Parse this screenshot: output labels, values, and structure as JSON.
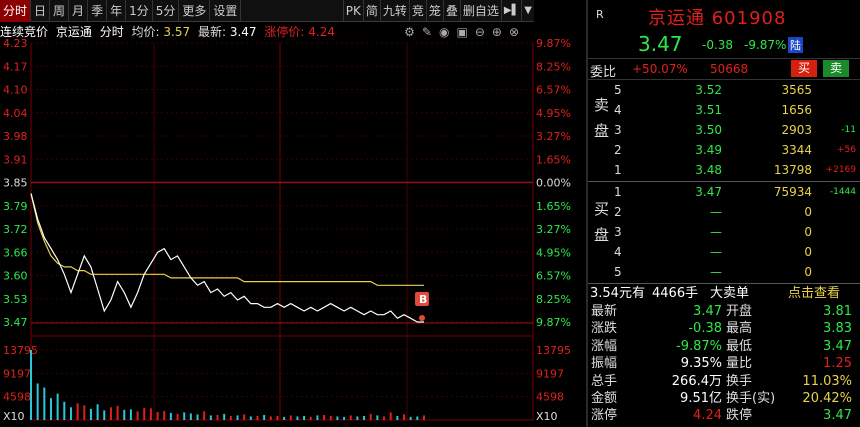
{
  "tabs": [
    "分时",
    "日",
    "周",
    "月",
    "季",
    "年",
    "1分",
    "5分",
    "更多",
    "设置"
  ],
  "tools": [
    "PK",
    "简",
    "九转",
    "竞",
    "笼",
    "叠",
    "删自选"
  ],
  "info": {
    "auction": "连续竞价",
    "name": "京运通",
    "kind": "分时",
    "avg_label": "均价:",
    "avg": "3.57",
    "last_label": "最新:",
    "last": "3.47",
    "limit_label": "涨停价:",
    "limit": "4.24"
  },
  "chart_data": {
    "type": "line",
    "prev_close": 3.85,
    "ylim": [
      3.47,
      4.23
    ],
    "left_ticks": [
      "4.23",
      "4.17",
      "4.10",
      "4.04",
      "3.98",
      "3.91",
      "3.85",
      "3.79",
      "3.72",
      "3.66",
      "3.60",
      "3.53",
      "3.47"
    ],
    "right_ticks": [
      "9.87%",
      "8.25%",
      "6.57%",
      "4.95%",
      "3.27%",
      "1.65%",
      "0.00%",
      "1.65%",
      "3.27%",
      "4.95%",
      "6.57%",
      "8.25%",
      "9.87%"
    ],
    "vol_left_ticks": [
      "13795",
      "9197",
      "4598"
    ],
    "vol_right_ticks": [
      "13795",
      "9197",
      "4598"
    ],
    "vol_unit": "X10",
    "marker": "B",
    "price": [
      3.82,
      3.75,
      3.7,
      3.67,
      3.64,
      3.6,
      3.55,
      3.6,
      3.65,
      3.62,
      3.56,
      3.5,
      3.53,
      3.58,
      3.55,
      3.51,
      3.55,
      3.6,
      3.63,
      3.66,
      3.67,
      3.64,
      3.65,
      3.62,
      3.59,
      3.57,
      3.58,
      3.55,
      3.56,
      3.54,
      3.55,
      3.53,
      3.54,
      3.52,
      3.52,
      3.51,
      3.51,
      3.52,
      3.51,
      3.52,
      3.51,
      3.5,
      3.51,
      3.5,
      3.51,
      3.52,
      3.51,
      3.5,
      3.51,
      3.5,
      3.49,
      3.5,
      3.49,
      3.49,
      3.5,
      3.48,
      3.49,
      3.48,
      3.47,
      3.47
    ],
    "avg_line": [
      3.82,
      3.74,
      3.69,
      3.65,
      3.63,
      3.62,
      3.62,
      3.61,
      3.61,
      3.6,
      3.6,
      3.6,
      3.6,
      3.6,
      3.6,
      3.6,
      3.6,
      3.6,
      3.6,
      3.6,
      3.6,
      3.59,
      3.59,
      3.59,
      3.59,
      3.59,
      3.59,
      3.59,
      3.59,
      3.59,
      3.59,
      3.59,
      3.58,
      3.58,
      3.58,
      3.58,
      3.58,
      3.58,
      3.58,
      3.58,
      3.58,
      3.58,
      3.58,
      3.58,
      3.58,
      3.58,
      3.58,
      3.58,
      3.58,
      3.58,
      3.58,
      3.58,
      3.57,
      3.57,
      3.57,
      3.57,
      3.57,
      3.57,
      3.57,
      3.57
    ],
    "volume": [
      13795,
      7200,
      6400,
      4300,
      5200,
      3600,
      2500,
      3300,
      2900,
      2200,
      3100,
      1900,
      2500,
      2800,
      2000,
      2100,
      1700,
      2400,
      2300,
      1600,
      1800,
      1400,
      1200,
      1500,
      1300,
      1100,
      1700,
      900,
      1000,
      1200,
      800,
      900,
      1100,
      700,
      800,
      1000,
      700,
      800,
      600,
      900,
      700,
      800,
      600,
      900,
      1000,
      800,
      700,
      600,
      900,
      700,
      800,
      1200,
      900,
      700,
      1500,
      800,
      1100,
      600,
      700,
      900
    ]
  },
  "quote": {
    "badge": "R",
    "name": "京运通",
    "code": "601908",
    "price": "3.47",
    "change": "-0.38",
    "pct": "-9.87%",
    "market": "陆"
  },
  "ratio": {
    "label": "委比",
    "pct": "+50.07%",
    "diff": "50668",
    "buy": "买",
    "sell": "卖"
  },
  "sell_side_label": [
    "卖",
    "盘"
  ],
  "buy_side_label": [
    "买",
    "盘"
  ],
  "asks": [
    {
      "lv": "5",
      "price": "3.52",
      "vol": "3565",
      "chg": ""
    },
    {
      "lv": "4",
      "price": "3.51",
      "vol": "1656",
      "chg": ""
    },
    {
      "lv": "3",
      "price": "3.50",
      "vol": "2903",
      "chg": "-11"
    },
    {
      "lv": "2",
      "price": "3.49",
      "vol": "3344",
      "chg": "+56"
    },
    {
      "lv": "1",
      "price": "3.48",
      "vol": "13798",
      "chg": "+2169"
    }
  ],
  "bids": [
    {
      "lv": "1",
      "price": "3.47",
      "vol": "75934",
      "chg": "-1444"
    },
    {
      "lv": "2",
      "price": "—",
      "vol": "0",
      "chg": ""
    },
    {
      "lv": "3",
      "price": "—",
      "vol": "0",
      "chg": ""
    },
    {
      "lv": "4",
      "price": "—",
      "vol": "0",
      "chg": ""
    },
    {
      "lv": "5",
      "price": "—",
      "vol": "0",
      "chg": ""
    }
  ],
  "volume_bar": {
    "price": "3.54元有",
    "hands": "4466手",
    "label": "大卖单",
    "link": "点击查看"
  },
  "stats": [
    {
      "k1": "最新",
      "v1": "3.47",
      "c1": "green",
      "k2": "开盘",
      "v2": "3.81",
      "c2": "green"
    },
    {
      "k1": "涨跌",
      "v1": "-0.38",
      "c1": "green",
      "k2": "最高",
      "v2": "3.83",
      "c2": "green"
    },
    {
      "k1": "涨幅",
      "v1": "-9.87%",
      "c1": "green",
      "k2": "最低",
      "v2": "3.47",
      "c2": "green"
    },
    {
      "k1": "振幅",
      "v1": "9.35%",
      "c1": "white",
      "k2": "量比",
      "v2": "1.25",
      "c2": "red"
    },
    {
      "k1": "总手",
      "v1": "266.4万",
      "c1": "white",
      "k2": "换手",
      "v2": "11.03%",
      "c2": "yellow"
    },
    {
      "k1": "金额",
      "v1": "9.51亿",
      "c1": "white",
      "k2": "换手(实)",
      "v2": "20.42%",
      "c2": "yellow"
    },
    {
      "k1": "涨停",
      "v1": "4.24",
      "c1": "red",
      "k2": "跌停",
      "v2": "3.47",
      "c2": "green"
    }
  ]
}
